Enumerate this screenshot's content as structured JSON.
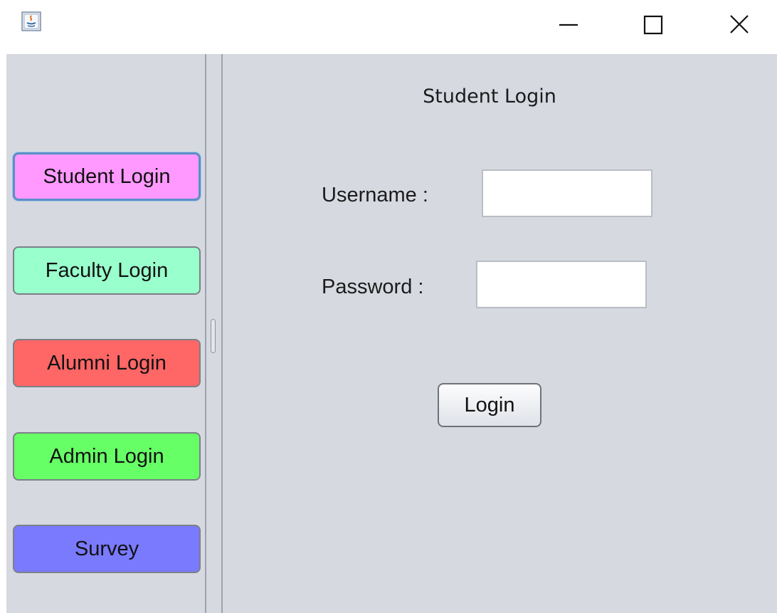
{
  "window_controls": {
    "minimize_icon": "minimize-icon",
    "maximize_icon": "maximize-icon",
    "close_icon": "close-icon"
  },
  "sidebar": {
    "items": [
      {
        "label": "Student Login",
        "color": "#ff99ff",
        "focused": true
      },
      {
        "label": "Faculty Login",
        "color": "#99ffcc"
      },
      {
        "label": "Alumni Login",
        "color": "#ff6666"
      },
      {
        "label": "Admin Login",
        "color": "#66ff66"
      },
      {
        "label": "Survey",
        "color": "#7a7aff"
      }
    ]
  },
  "form": {
    "title": "Student Login",
    "username_label": "Username :",
    "username_value": "",
    "password_label": "Password :",
    "password_value": "",
    "login_label": "Login"
  },
  "colors": {
    "panel_background": "#d6d9e0"
  }
}
